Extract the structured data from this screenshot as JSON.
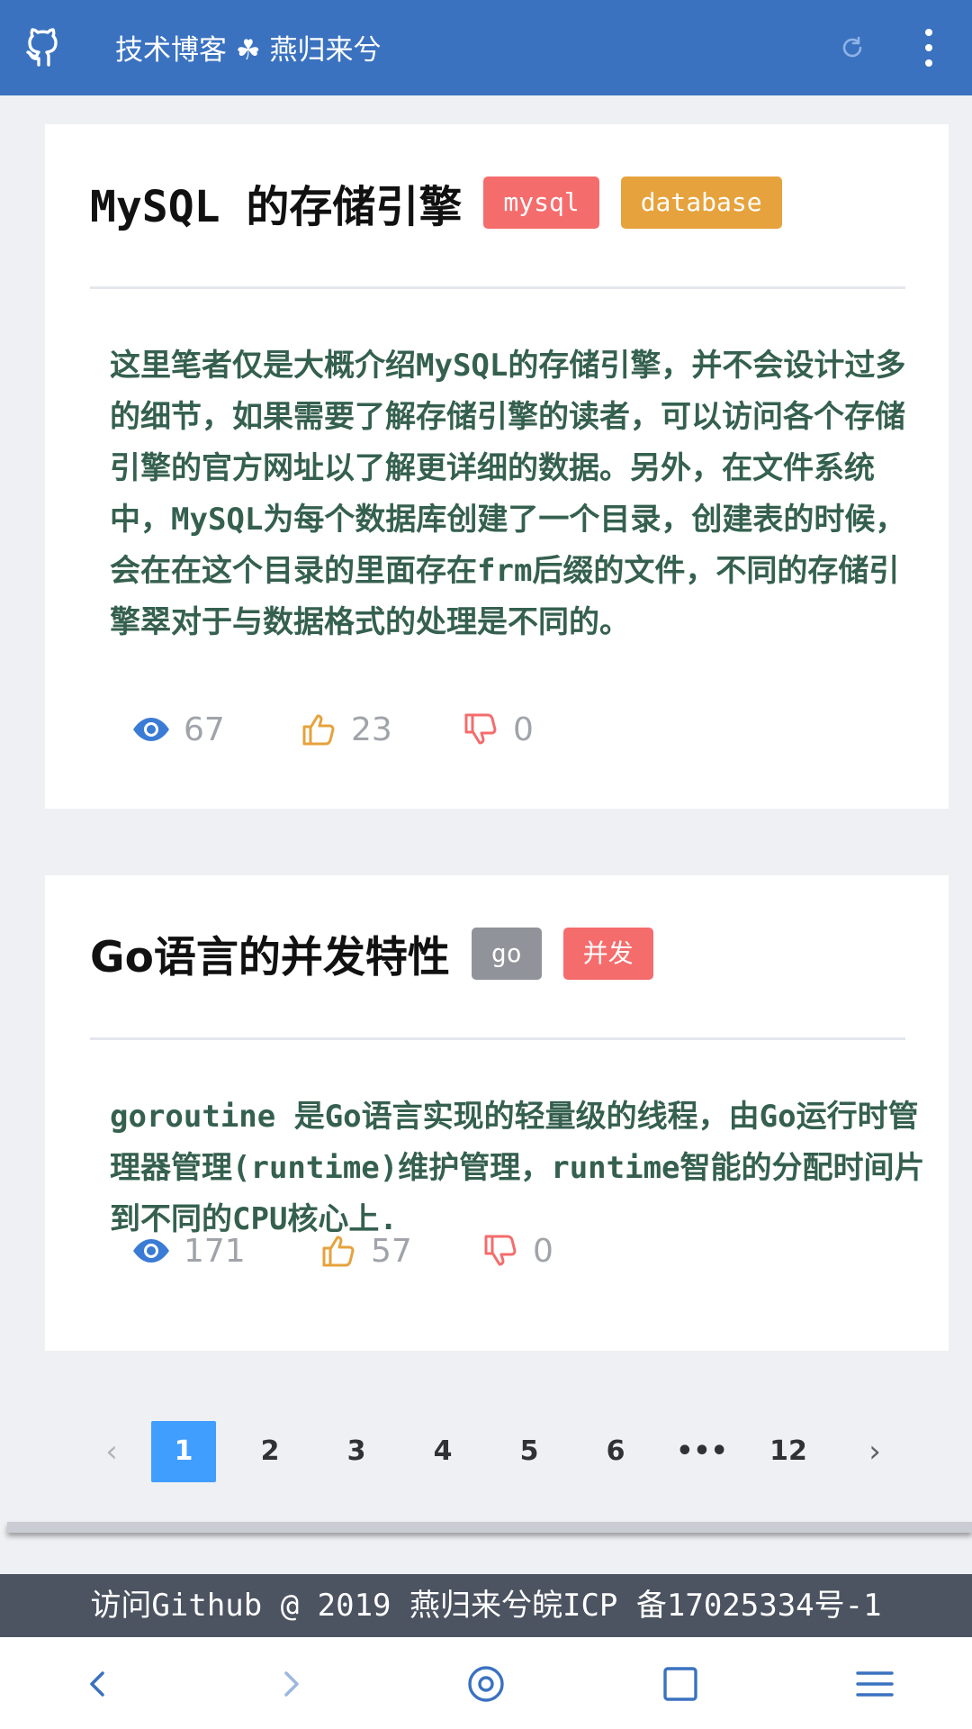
{
  "appbar": {
    "title": "技术博客 ☘ 燕归来兮",
    "icons": [
      "github-icon",
      "refresh-icon",
      "more-vertical-icon"
    ]
  },
  "posts": [
    {
      "title": "MySQL 的存储引擎",
      "tags": [
        "mysql",
        "database"
      ],
      "excerpt": "这里笔者仅是大概介绍MySQL的存储引擎，并不会设计过多的细节，如果需要了解存储引擎的读者，可以访问各个存储引擎的官方网址以了解更详细的数据。另外，在文件系统中，MySQL为每个数据库创建了一个目录，创建表的时候，会在在这个目录的里面存在frm后缀的文件，不同的存储引擎翠对于与数据格式的处理是不同的。",
      "views": "67",
      "likes": "23",
      "dislikes": "0"
    },
    {
      "title": "Go语言的并发特性",
      "tags": [
        "go",
        "并发"
      ],
      "excerpt": "goroutine 是Go语言实现的轻量级的线程，由Go运行时管理器管理(runtime)维护管理，runtime智能的分配时间片到不同的CPU核心上.",
      "views": "171",
      "likes": "57",
      "dislikes": "0"
    }
  ],
  "pagination": {
    "prev": "‹",
    "pages": [
      "1",
      "2",
      "3",
      "4",
      "5",
      "6",
      "•••",
      "12"
    ],
    "next": "›",
    "current": "1"
  },
  "footer": {
    "text": "访问Github @ 2019 燕归来兮皖ICP 备17025334号-1"
  },
  "colors": {
    "appbar": "#3a72c0",
    "tag_red": "#f56c6c",
    "tag_orange": "#e6a23c",
    "tag_gray": "#909399",
    "active_page": "#409eff",
    "view_icon": "#3a7bd5",
    "like_icon": "#e6a23c",
    "dislike_icon": "#f56c6c"
  }
}
